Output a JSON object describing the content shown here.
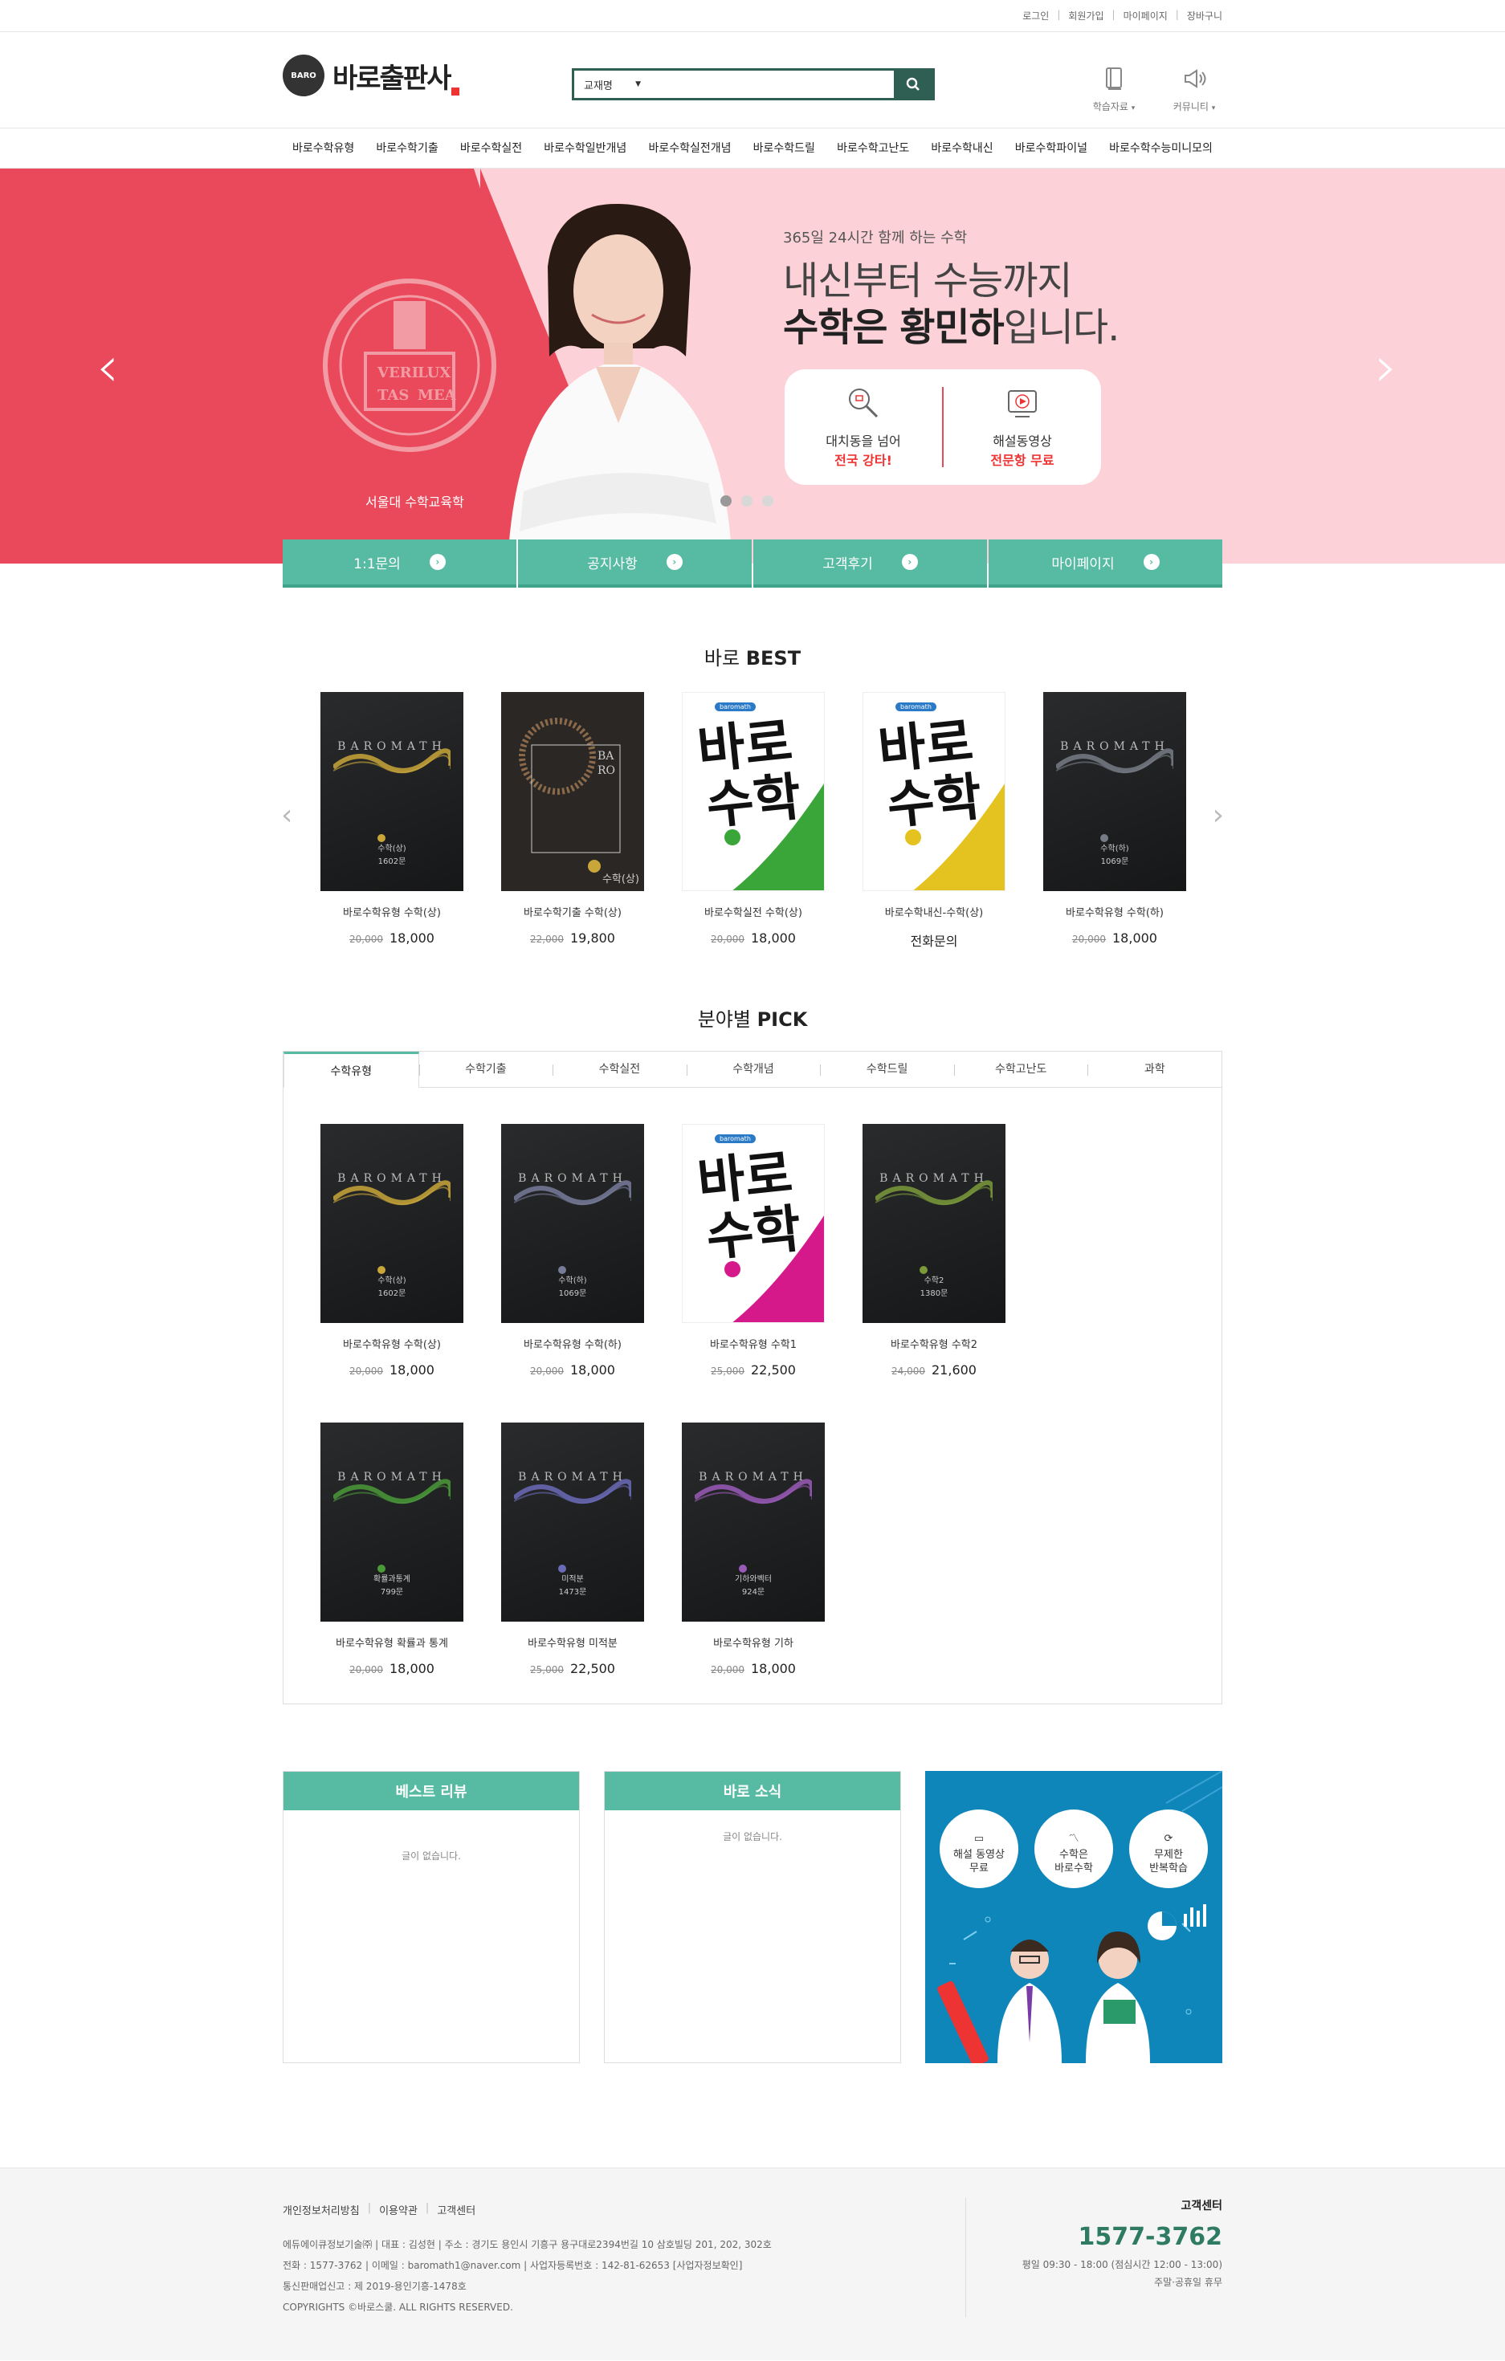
{
  "topbar": {
    "links": [
      "로그인",
      "회원가입",
      "마이페이지",
      "장바구니"
    ]
  },
  "brand": {
    "mark": "BARO",
    "name": "바로출판사"
  },
  "search": {
    "select_label": "교재명",
    "placeholder": ""
  },
  "header_icons": [
    {
      "label": "학습자료",
      "icon": "book-icon"
    },
    {
      "label": "커뮤니티",
      "icon": "megaphone-icon"
    }
  ],
  "nav": [
    "바로수학유형",
    "바로수학기출",
    "바로수학실전",
    "바로수학일반개념",
    "바로수학실전개념",
    "바로수학드릴",
    "바로수학고난도",
    "바로수학내신",
    "바로수학파이널",
    "바로수학수능미니모의"
  ],
  "hero": {
    "subtitle": "365일 24시간 함께 하는 수학",
    "line1": "내신부터 수능까지",
    "line2_bold": "수학은 황민하",
    "line2_rest": "입니다.",
    "emblem_caption": "서울대 수학교육학",
    "emblem_text": [
      "VERI",
      "LUX",
      "TAS",
      "MEA"
    ],
    "card": [
      {
        "line1": "대치동을 넘어",
        "line2": "전국 강타!",
        "icon": "search-trophy-icon"
      },
      {
        "line1": "해설동영상",
        "line2": "전문항 무료",
        "icon": "video-icon"
      }
    ],
    "slide_count": 3,
    "active_slide": 1
  },
  "quick": [
    "1:1문의",
    "공지사항",
    "고객후기",
    "마이페이지"
  ],
  "best": {
    "title_normal": "바로 ",
    "title_bold": "BEST",
    "items": [
      {
        "name": "바로수학유형 수학(상)",
        "orig": "20,000",
        "price": "18,000",
        "cover": "dark",
        "wave": "#c9a63a",
        "sub": "수학(상)",
        "count": "1602문"
      },
      {
        "name": "바로수학기출 수학(상)",
        "orig": "22,000",
        "price": "19,800",
        "cover": "eclipse",
        "sub": "수학(상)",
        "box": "BA RO"
      },
      {
        "name": "바로수학실전 수학(상)",
        "orig": "20,000",
        "price": "18,000",
        "cover": "white",
        "accent": "#3aa63a"
      },
      {
        "name": "바로수학내신-수학(상)",
        "orig": "",
        "price": "전화문의",
        "cover": "white",
        "accent": "#e4c21f"
      },
      {
        "name": "바로수학유형 수학(하)",
        "orig": "20,000",
        "price": "18,000",
        "cover": "dark",
        "wave": "#777b85",
        "sub": "수학(하)",
        "count": "1069문"
      }
    ]
  },
  "pick": {
    "title_normal": "분야별 ",
    "title_bold": "PICK",
    "tabs": [
      "수학유형",
      "수학기출",
      "수학실전",
      "수학개념",
      "수학드릴",
      "수학고난도",
      "과학"
    ],
    "active_tab": 0,
    "items": [
      {
        "name": "바로수학유형 수학(상)",
        "orig": "20,000",
        "price": "18,000",
        "cover": "dark",
        "wave": "#c9a63a",
        "sub": "수학(상)",
        "count": "1602문"
      },
      {
        "name": "바로수학유형 수학(하)",
        "orig": "20,000",
        "price": "18,000",
        "cover": "dark",
        "wave": "#777b9a",
        "sub": "수학(하)",
        "count": "1069문"
      },
      {
        "name": "바로수학유형 수학1",
        "orig": "25,000",
        "price": "22,500",
        "cover": "white",
        "accent": "#d6198a"
      },
      {
        "name": "바로수학유형 수학2",
        "orig": "24,000",
        "price": "21,600",
        "cover": "dark",
        "wave": "#7a9a3a",
        "sub": "수학2",
        "count": "1380문"
      },
      {
        "name": "바로수학유형 확률과 통계",
        "orig": "20,000",
        "price": "18,000",
        "cover": "dark",
        "wave": "#4a9a3a",
        "sub": "확률과통계",
        "count": "799문"
      },
      {
        "name": "바로수학유형 미적분",
        "orig": "25,000",
        "price": "22,500",
        "cover": "dark",
        "wave": "#6a6ab8",
        "sub": "미적분",
        "count": "1473문"
      },
      {
        "name": "바로수학유형 기하",
        "orig": "20,000",
        "price": "18,000",
        "cover": "dark",
        "wave": "#9a5ab8",
        "sub": "기하와벡터",
        "count": "924문"
      }
    ]
  },
  "boards": [
    {
      "title": "베스트 리뷰",
      "empty": "글이 없습니다."
    },
    {
      "title": "바로 소식",
      "empty": "글이 없습니다."
    }
  ],
  "promo": {
    "circles": [
      {
        "l1": "해설 동영상",
        "l2": "무료",
        "icon": "video-icon"
      },
      {
        "l1": "수학은",
        "l2": "바로수학",
        "icon": "chart-icon"
      },
      {
        "l1": "무제한",
        "l2": "반복학습",
        "icon": "repeat-icon"
      }
    ]
  },
  "footer": {
    "links": [
      "개인정보처리방침",
      "이용약관",
      "고객센터"
    ],
    "info1": "에듀에이큐정보기술㈜  |  대표 : 김성현  |  주소 : 경기도 용인시 기흥구 용구대로2394번길 10 삼호빌딩 201, 202, 302호",
    "info2": "전화 : 1577-3762  |  이메일 : baromath1@naver.com  |  사업자등록번호 : 142-81-62653 [사업자정보확인]",
    "info3": "통신판매업신고 : 제 2019-용인기흥-1478호",
    "copyright": "COPYRIGHTS ©바로스쿨. ALL RIGHTS RESERVED.",
    "cs_title": "고객센터",
    "cs_phone": "1577-3762",
    "cs_hours1": "평일 09:30 - 18:00 (점심시간 12:00 - 13:00)",
    "cs_hours2": "주말·공휴일 휴무"
  },
  "colors": {
    "accent": "#57bba3",
    "search": "#2f5f52",
    "hero_red": "#e9495a",
    "hero_pink": "#fcd2d8",
    "phone": "#2f7a62"
  }
}
